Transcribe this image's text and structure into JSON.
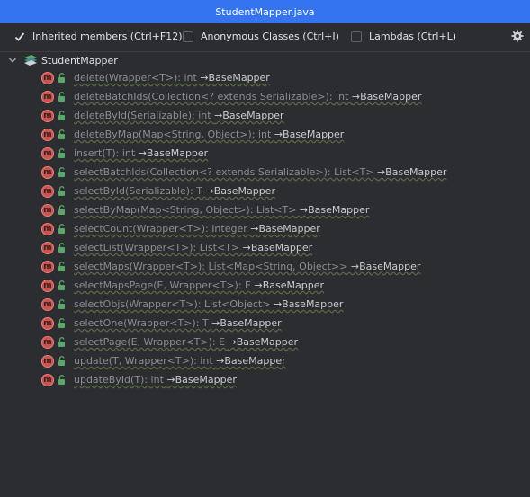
{
  "window": {
    "title": "StudentMapper.java"
  },
  "toolbar": {
    "inherited": {
      "label": "Inherited members (Ctrl+F12)",
      "checked": true
    },
    "anonymous": {
      "label": "Anonymous Classes (Ctrl+I)",
      "checked": false
    },
    "lambdas": {
      "label": "Lambdas (Ctrl+L)",
      "checked": false
    },
    "settings_icon": "gear-icon"
  },
  "tree": {
    "root": {
      "label": "StudentMapper",
      "icon": "interface-icon",
      "expanded": true
    },
    "methods": [
      {
        "sig": "delete(Wrapper<T>): int",
        "owner": "→BaseMapper"
      },
      {
        "sig": "deleteBatchIds(Collection<? extends Serializable>): int",
        "owner": "→BaseMapper"
      },
      {
        "sig": "deleteById(Serializable): int",
        "owner": "→BaseMapper"
      },
      {
        "sig": "deleteByMap(Map<String, Object>): int",
        "owner": "→BaseMapper"
      },
      {
        "sig": "insert(T): int",
        "owner": "→BaseMapper"
      },
      {
        "sig": "selectBatchIds(Collection<? extends Serializable>): List<T>",
        "owner": "→BaseMapper"
      },
      {
        "sig": "selectById(Serializable): T",
        "owner": "→BaseMapper"
      },
      {
        "sig": "selectByMap(Map<String, Object>): List<T>",
        "owner": "→BaseMapper"
      },
      {
        "sig": "selectCount(Wrapper<T>): Integer",
        "owner": "→BaseMapper"
      },
      {
        "sig": "selectList(Wrapper<T>): List<T>",
        "owner": "→BaseMapper"
      },
      {
        "sig": "selectMaps(Wrapper<T>): List<Map<String, Object>>",
        "owner": "→BaseMapper"
      },
      {
        "sig": "selectMapsPage(E, Wrapper<T>): E",
        "owner": "→BaseMapper"
      },
      {
        "sig": "selectObjs(Wrapper<T>): List<Object>",
        "owner": "→BaseMapper"
      },
      {
        "sig": "selectOne(Wrapper<T>): T",
        "owner": "→BaseMapper"
      },
      {
        "sig": "selectPage(E, Wrapper<T>): E",
        "owner": "→BaseMapper"
      },
      {
        "sig": "update(T, Wrapper<T>): int",
        "owner": "→BaseMapper"
      },
      {
        "sig": "updateById(T): int",
        "owner": "→BaseMapper"
      }
    ],
    "method_icon_letter": "m"
  }
}
